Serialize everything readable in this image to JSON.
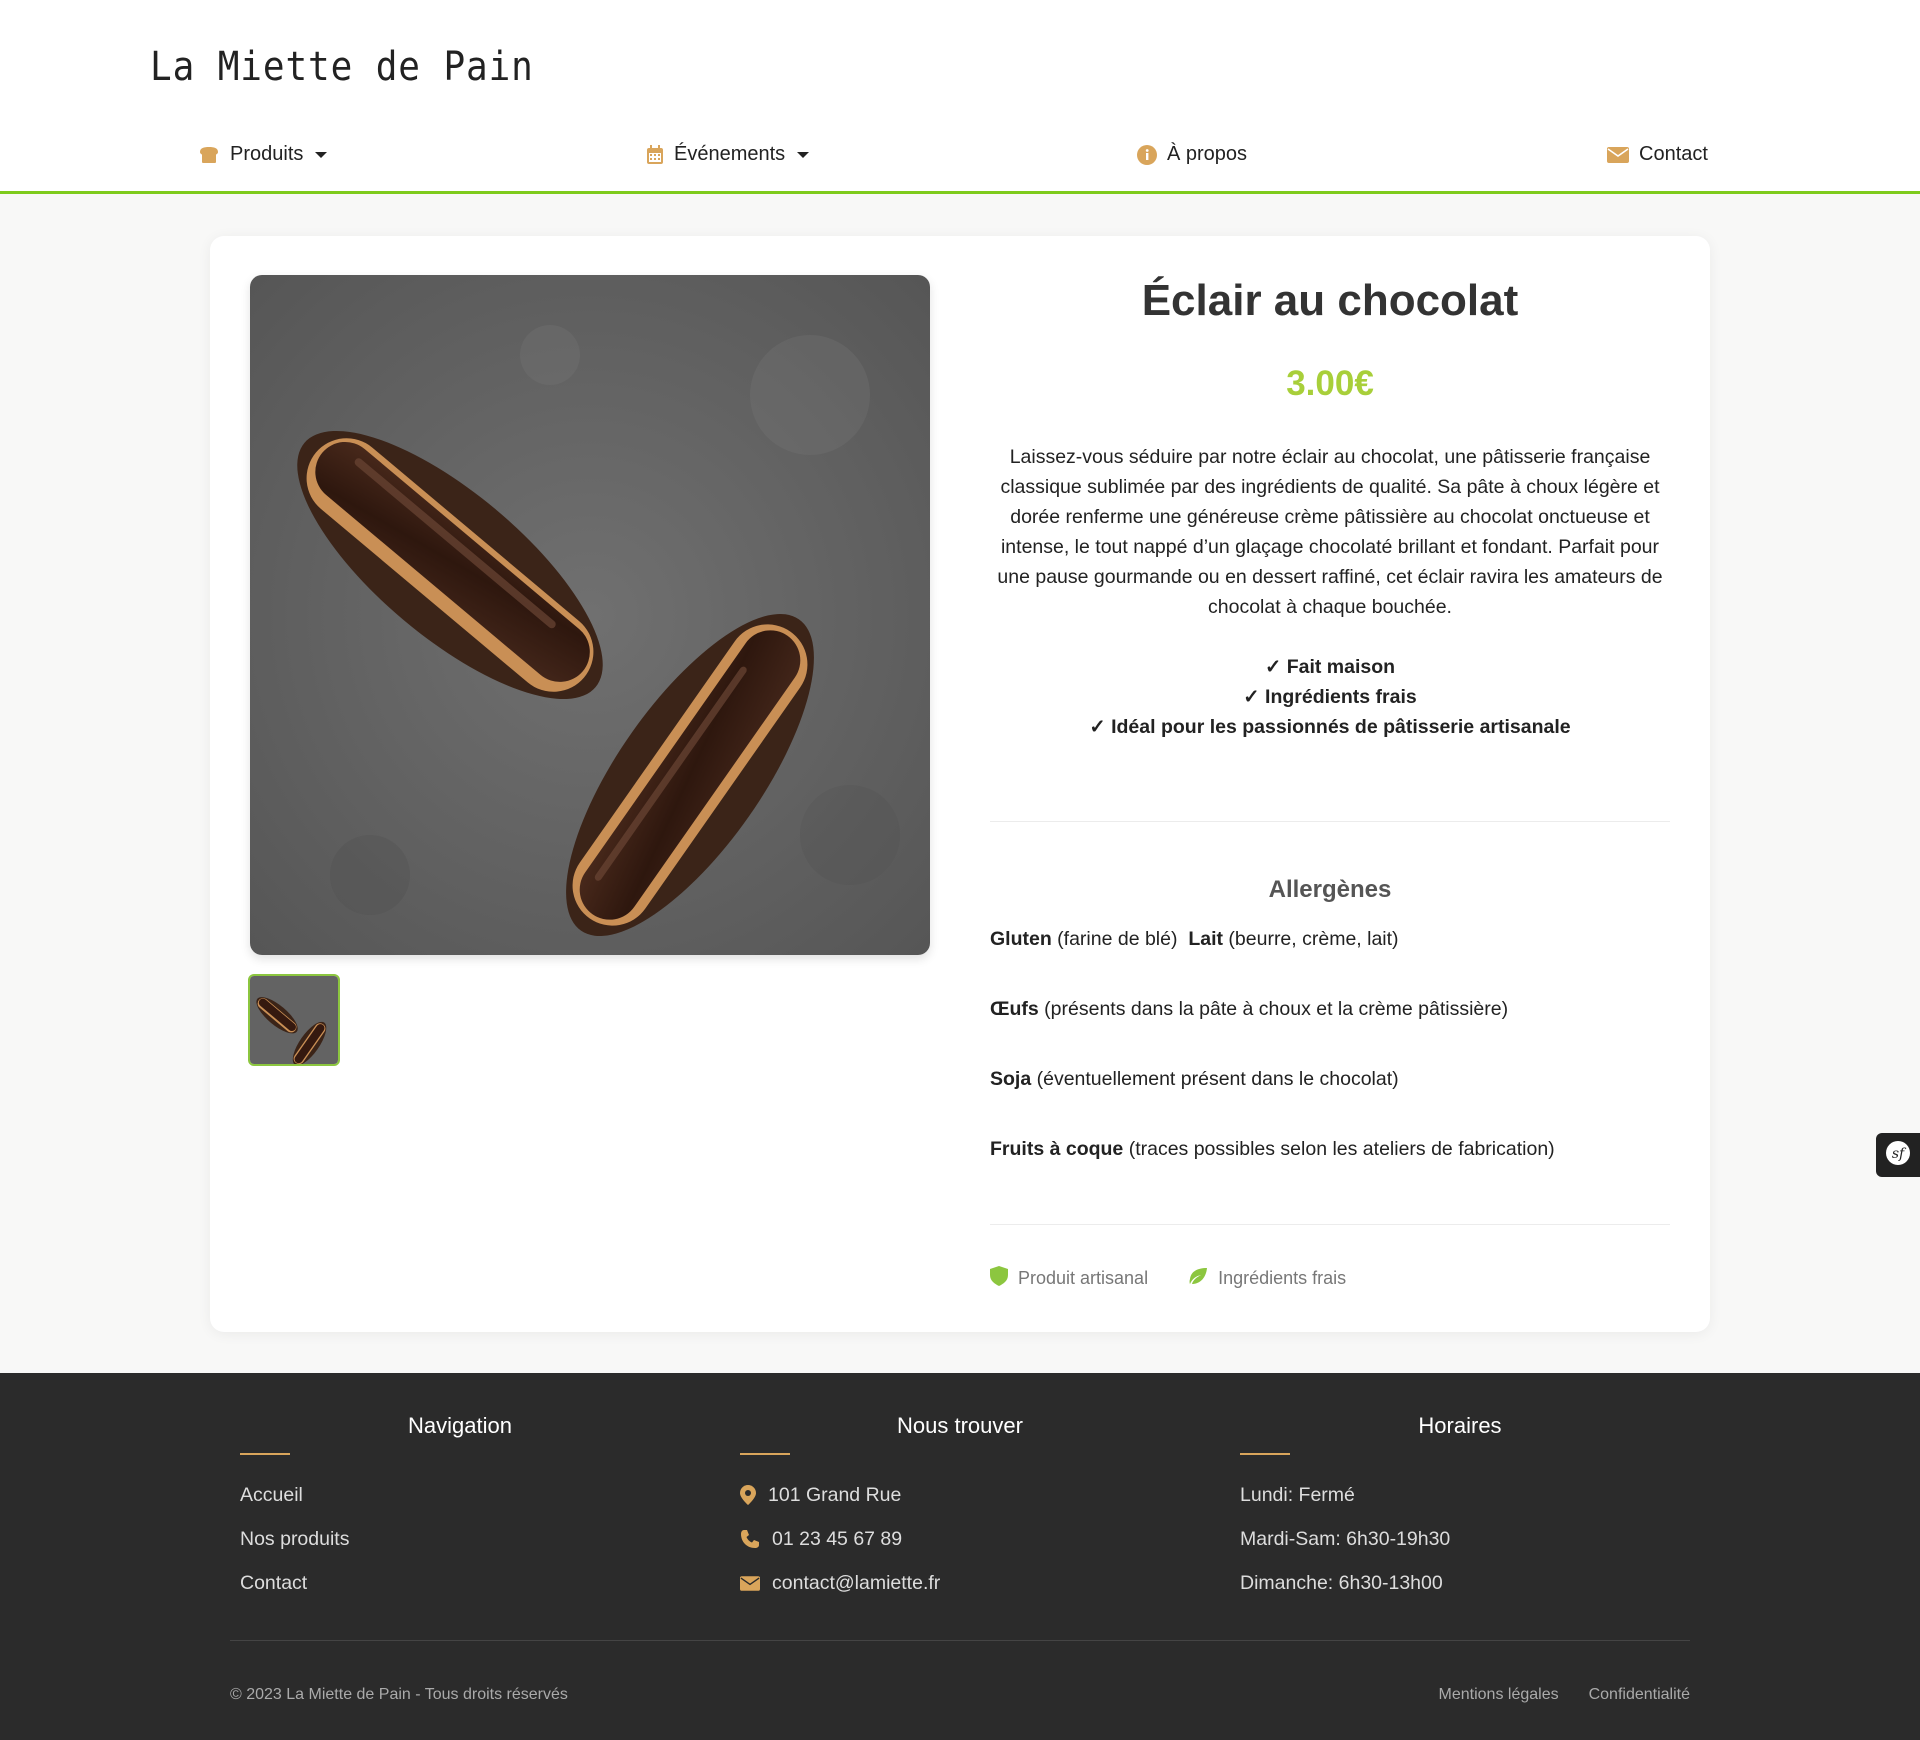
{
  "header": {
    "logo": "La Miette de Pain",
    "nav": {
      "products": "Produits",
      "events": "Événements",
      "about": "À propos",
      "contact": "Contact"
    }
  },
  "product": {
    "title": "Éclair au chocolat",
    "price": "3.00€",
    "description": "Laissez-vous séduire par notre éclair au chocolat, une pâtisserie française classique sublimée par des ingrédients de qualité. Sa pâte à choux légère et dorée renferme une généreuse crème pâtissière au chocolat onctueuse et intense, le tout nappé d’un glaçage chocolaté brillant et fondant. Parfait pour une pause gourmande ou en dessert raffiné, cet éclair ravira les amateurs de chocolat à chaque bouchée.",
    "features": [
      "✓ Fait maison",
      "✓ Ingrédients frais",
      "✓ Idéal pour les passionnés de pâtisserie artisanale"
    ],
    "allergens_title": "Allergènes",
    "allergens": [
      {
        "name": "Gluten",
        "detail": " (farine de blé)"
      },
      {
        "name": "Lait",
        "detail": " (beurre, crème, lait)"
      },
      {
        "name": "Œufs",
        "detail": " (présents dans la pâte à choux et la crème pâtissière)"
      },
      {
        "name": "Soja",
        "detail": " (éventuellement présent dans le chocolat)"
      },
      {
        "name": "Fruits à coque",
        "detail": " (traces possibles selon les ateliers de fabrication)"
      }
    ],
    "badges": [
      "Produit artisanal",
      "Ingrédients frais"
    ]
  },
  "footer": {
    "navigation": {
      "title": "Navigation",
      "links": [
        "Accueil",
        "Nos produits",
        "Contact"
      ]
    },
    "find_us": {
      "title": "Nous trouver",
      "address": "101 Grand Rue",
      "phone": "01 23 45 67 89",
      "email": "contact@lamiette.fr"
    },
    "hours": {
      "title": "Horaires",
      "lines": [
        "Lundi: Fermé",
        "Mardi-Sam: 6h30-19h30",
        "Dimanche: 6h30-13h00"
      ]
    },
    "copyright": "© 2023 La Miette de Pain - Tous droits réservés",
    "legal": "Mentions légales",
    "privacy": "Confidentialité"
  },
  "colors": {
    "accent_green": "#7ecb1c",
    "price_green": "#a8cf3a",
    "icon_gold": "#d9a55b",
    "footer_bg": "#2b2b2b"
  },
  "icons": [
    "bread-icon",
    "calendar-icon",
    "info-icon",
    "envelope-icon",
    "shield-icon",
    "leaf-icon",
    "map-pin-icon",
    "phone-icon",
    "symfony-icon"
  ]
}
